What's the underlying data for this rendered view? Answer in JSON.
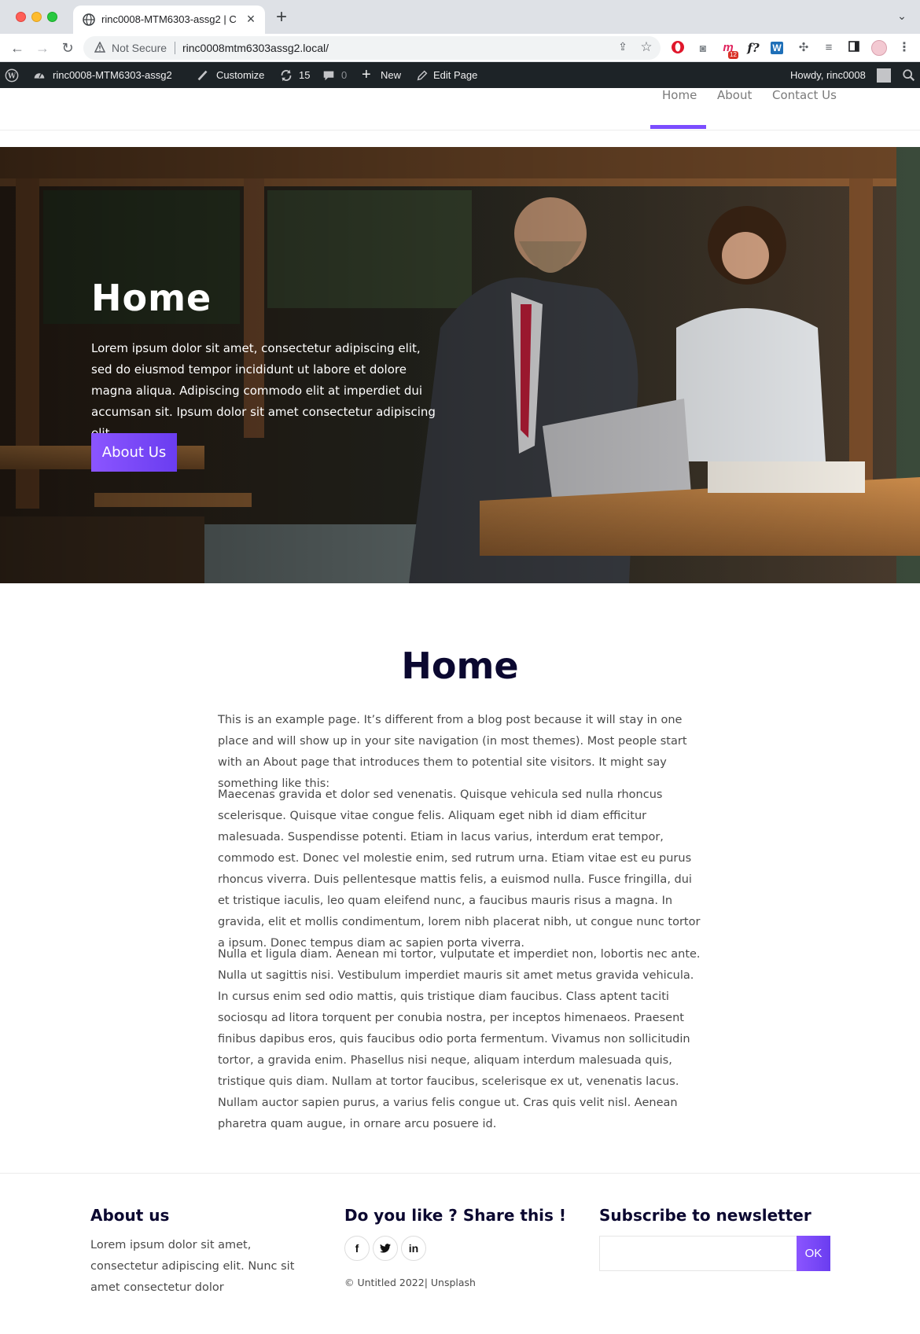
{
  "browser": {
    "tab_title": "rinc0008-MTM6303-assg2 | C",
    "new_tab_glyph": "+",
    "close_glyph": "×",
    "security_label": "Not Secure",
    "url": "rinc0008mtm6303assg2.local/",
    "extension_badge": "12",
    "icons": [
      "globe-icon",
      "back-icon",
      "forward-icon",
      "reload-icon",
      "warning-icon",
      "share-icon",
      "star-icon",
      "puzzle-icon",
      "kebab-icon"
    ]
  },
  "admin_bar": {
    "site_name": "rinc0008-MTM6303-assg2",
    "customize": "Customize",
    "updates_count": "15",
    "comments_count": "0",
    "new_label": "New",
    "edit_label": "Edit Page",
    "howdy": "Howdy, rinc0008"
  },
  "nav": {
    "items": [
      "Home",
      "About",
      "Contact Us"
    ],
    "active": "Home",
    "accent_color": "#7b4dff"
  },
  "hero": {
    "title": "Home",
    "text": "Lorem ipsum dolor sit amet, consectetur adipiscing elit, sed do eiusmod tempor incididunt ut labore et dolore magna aliqua. Adipiscing commodo elit at imperdiet dui accumsan sit. Ipsum dolor sit amet consectetur adipiscing elit.",
    "button_label": "About Us"
  },
  "main": {
    "title": "Home",
    "paragraphs": [
      "This is an example page. It’s different from a blog post because it will stay in one place and will show up in your site navigation (in most themes). Most people start with an About page that introduces them to potential site visitors. It might say something like this:",
      "Maecenas gravida et dolor sed venenatis. Quisque vehicula sed nulla rhoncus scelerisque. Quisque vitae congue felis. Aliquam eget nibh id diam efficitur malesuada. Suspendisse potenti. Etiam in lacus varius, interdum erat tempor, commodo est. Donec vel molestie enim, sed rutrum urna. Etiam vitae est eu purus rhoncus viverra. Duis pellentesque mattis felis, a euismod nulla. Fusce fringilla, dui et tristique iaculis, leo quam eleifend nunc, a faucibus mauris risus a magna. In gravida, elit et mollis condimentum, lorem nibh placerat nibh, ut congue nunc tortor a ipsum. Donec tempus diam ac sapien porta viverra.",
      "Nulla et ligula diam. Aenean mi tortor, vulputate et imperdiet non, lobortis nec ante. Nulla ut sagittis nisi. Vestibulum imperdiet mauris sit amet metus gravida vehicula. In cursus enim sed odio mattis, quis tristique diam faucibus. Class aptent taciti sociosqu ad litora torquent per conubia nostra, per inceptos himenaeos. Praesent finibus dapibus eros, quis faucibus odio porta fermentum. Vivamus non sollicitudin tortor, a gravida enim. Phasellus nisi neque, aliquam interdum malesuada quis, tristique quis diam. Nullam at tortor faucibus, scelerisque ex ut, venenatis lacus. Nullam auctor sapien purus, a varius felis congue ut. Cras quis velit nisl. Aenean pharetra quam augue, in ornare arcu posuere id."
    ]
  },
  "footer": {
    "about_title": "About us",
    "about_text": "Lorem ipsum dolor sit amet, consectetur adipiscing elit. Nunc sit amet consectetur dolor",
    "share_title": "Do you like ? Share this !",
    "social": [
      {
        "name": "facebook-icon",
        "glyph": "f"
      },
      {
        "name": "twitter-icon",
        "glyph": "t"
      },
      {
        "name": "linkedin-icon",
        "glyph": "in"
      }
    ],
    "copyright": "© Untitled 2022| Unsplash",
    "newsletter_title": "Subscribe to newsletter",
    "newsletter_placeholder": "",
    "newsletter_button": "OK"
  }
}
